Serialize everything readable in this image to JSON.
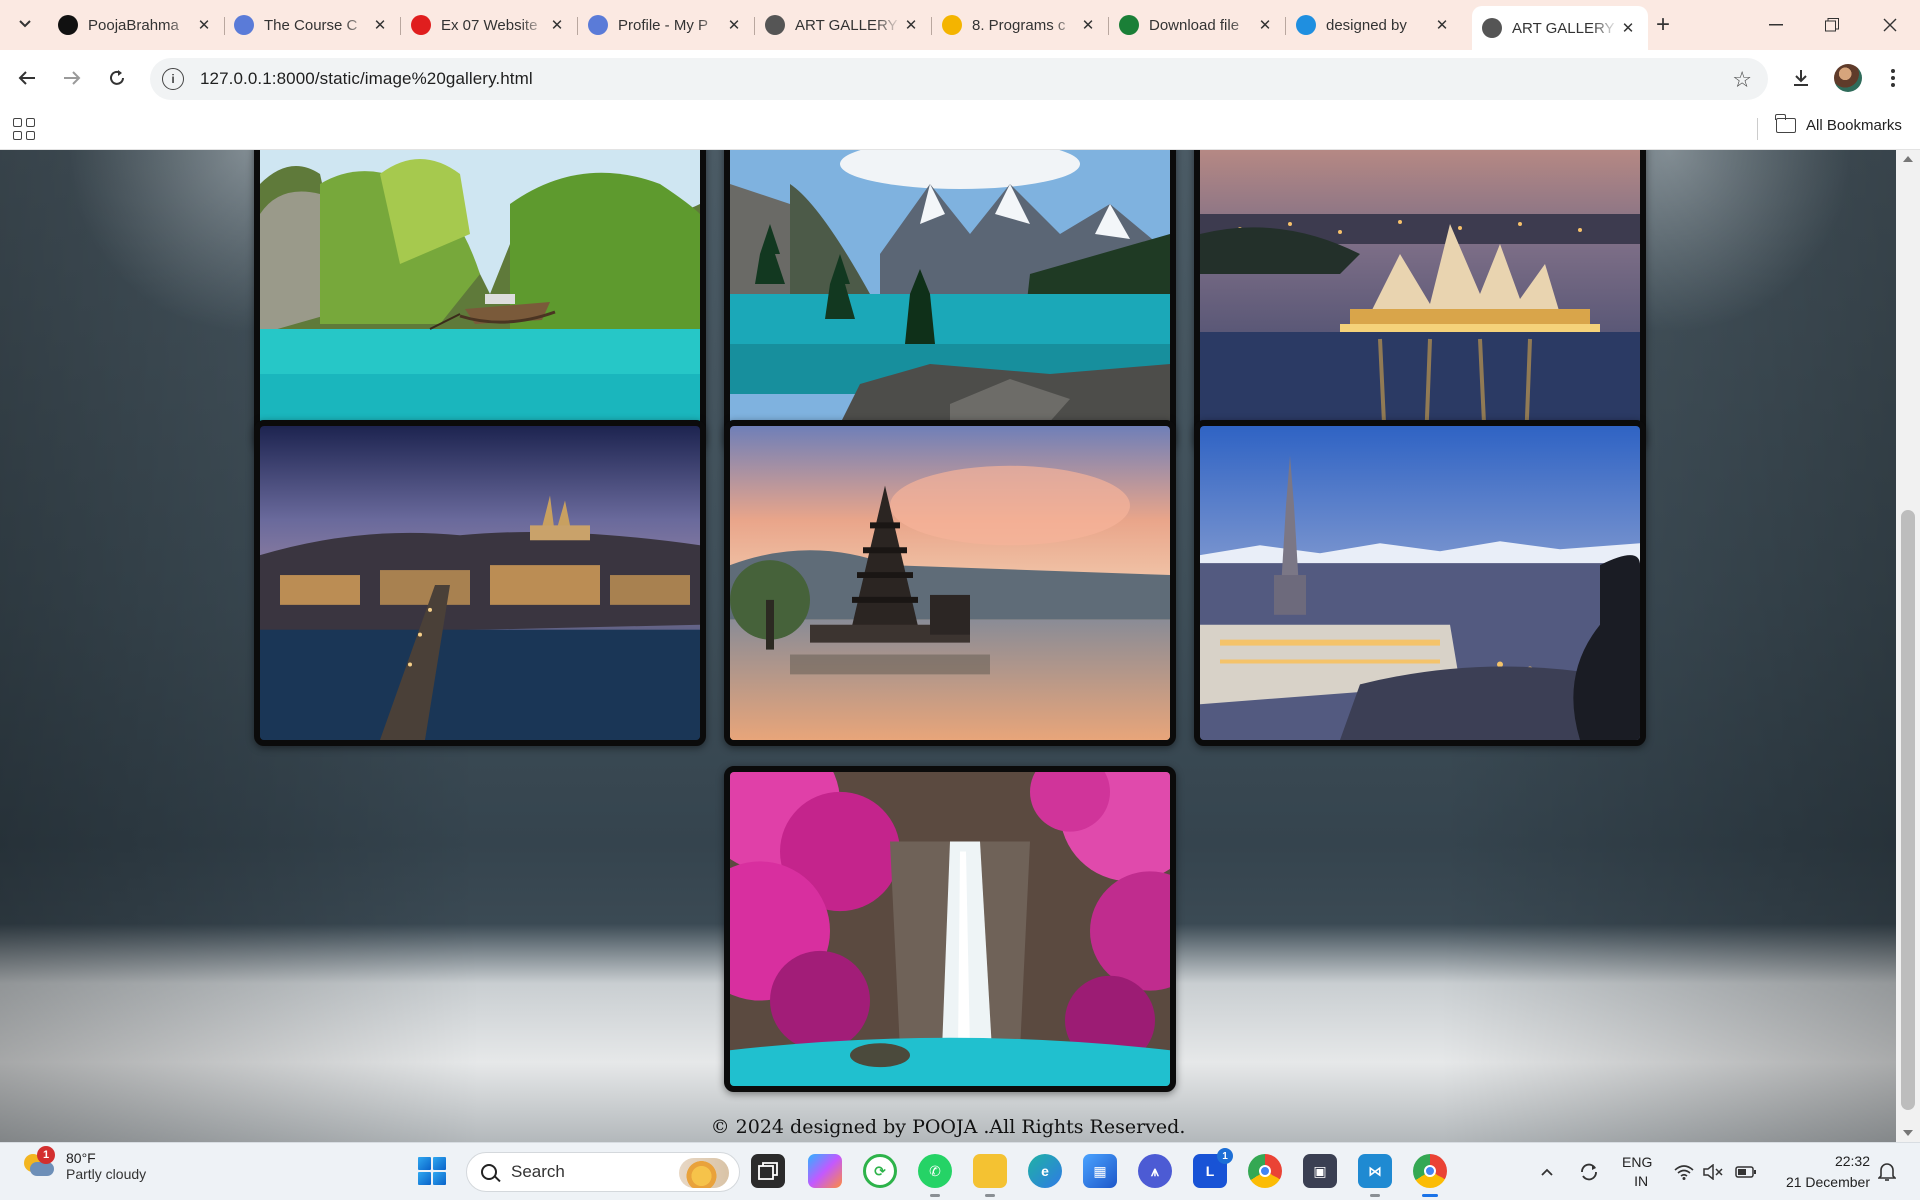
{
  "browser": {
    "tabs": [
      {
        "title": "PoojaBrahma",
        "favicon": "github-icon",
        "color": "#111111",
        "active": false
      },
      {
        "title": "The Course C",
        "favicon": "skillrack-icon",
        "color": "#5a7bd8",
        "active": false
      },
      {
        "title": "Ex 07 Website",
        "favicon": "youtube-icon",
        "color": "#e01e1e",
        "active": false
      },
      {
        "title": "Profile - My P",
        "favicon": "skillrack-icon",
        "color": "#5a7bd8",
        "active": false
      },
      {
        "title": "ART GALLERY",
        "favicon": "globe-icon",
        "color": "#555555",
        "active": false
      },
      {
        "title": "8. Programs c",
        "favicon": "slides-icon",
        "color": "#f4b400",
        "active": false
      },
      {
        "title": "Download file",
        "favicon": "w-icon",
        "color": "#1a7f37",
        "active": false
      },
      {
        "title": "designed by",
        "favicon": "edge-icon",
        "color": "#1f8fe0",
        "active": false
      },
      {
        "title": "ART GALLERY",
        "favicon": "globe-icon",
        "color": "#555555",
        "active": true
      }
    ],
    "url": "127.0.0.1:8000/static/image%20gallery.html",
    "bookmarks_label": "All Bookmarks"
  },
  "page": {
    "images": [
      {
        "name": "phi-phi-island-lagoon"
      },
      {
        "name": "moraine-lake-mountains"
      },
      {
        "name": "sydney-opera-house-night"
      },
      {
        "name": "prague-charles-bridge-dusk"
      },
      {
        "name": "bali-ulun-danu-temple-sunset"
      },
      {
        "name": "turin-mole-antonelliana-dusk"
      },
      {
        "name": "erawan-waterfall-pink-trees"
      }
    ],
    "footer": "© 2024 designed by POOJA .All Rights Reserved."
  },
  "taskbar": {
    "weather_temp": "80°F",
    "weather_desc": "Partly cloudy",
    "weather_badge": "1",
    "search_label": "Search",
    "lang_top": "ENG",
    "lang_bottom": "IN",
    "time": "22:32",
    "date": "21 December",
    "lawnchair_badge": "1"
  }
}
